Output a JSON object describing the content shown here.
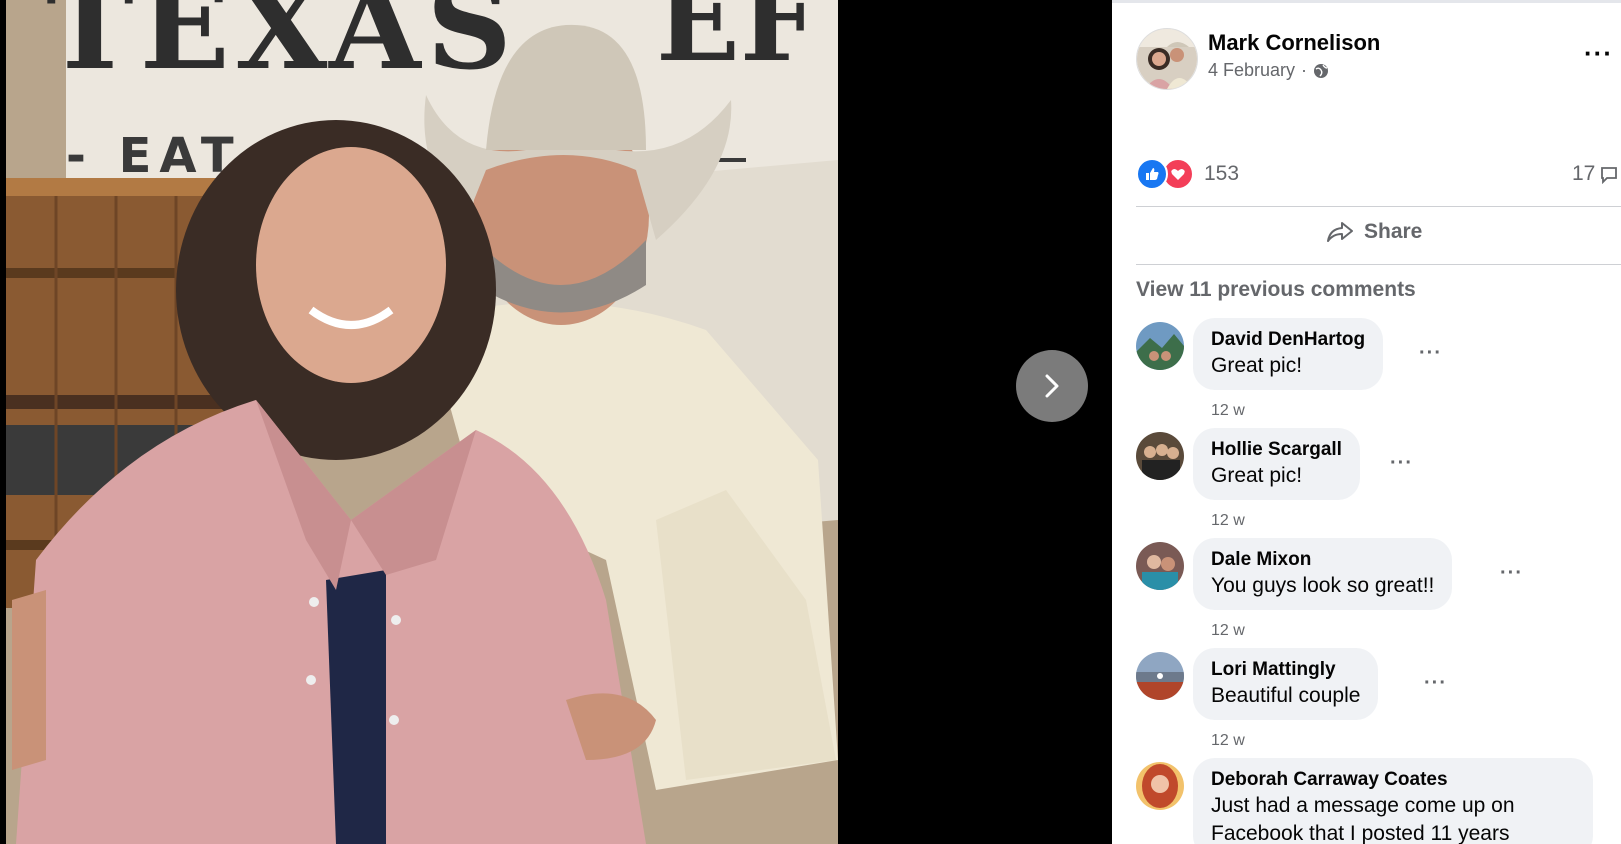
{
  "viewer": {
    "banner_main": "TEXAS",
    "banner_tail": "EF",
    "banner_sub": "- EAT BE"
  },
  "post": {
    "author": "Mark Cornelison",
    "date": "4 February",
    "separator": "·",
    "privacy_icon": "globe-icon",
    "reaction_count": "153",
    "comment_count": "17",
    "share_label": "Share",
    "view_previous": "View 11 previous comments",
    "more": "···"
  },
  "comments": [
    {
      "name": "David DenHartog",
      "text": "Great pic!",
      "time": "12 w",
      "more": "···",
      "avatar_color": "#3d6e4a"
    },
    {
      "name": "Hollie Scargall",
      "text": "Great pic!",
      "time": "12 w",
      "more": "···",
      "avatar_color": "#5a4a3a"
    },
    {
      "name": "Dale Mixon",
      "text": "You guys look so great!!",
      "time": "12 w",
      "more": "···",
      "avatar_color": "#7a5a55"
    },
    {
      "name": "Lori Mattingly",
      "text": "Beautiful couple",
      "time": "12 w",
      "more": "···",
      "avatar_color": "#6d7a8c"
    },
    {
      "name": "Deborah Carraway Coates",
      "text": "Just had a message come up on",
      "text2": "Facebook that I posted 11 years",
      "avatar_color": "#c0492b"
    }
  ],
  "colors": {
    "like": "#1877f2",
    "love": "#f33e58",
    "bubble": "#f0f2f5",
    "muted": "#65676b"
  }
}
